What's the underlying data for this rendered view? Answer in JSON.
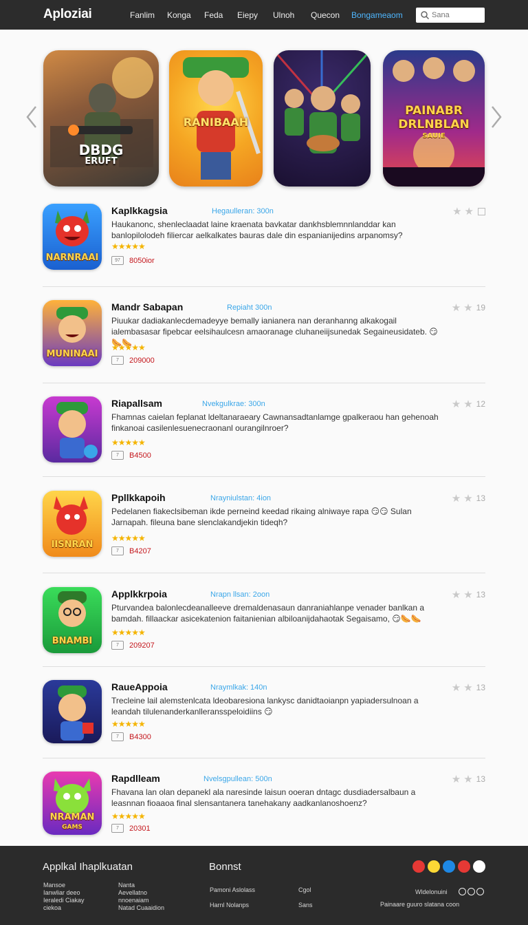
{
  "header": {
    "brand": "Aploziai",
    "nav": [
      "Fanlim",
      "Konga",
      "Feda",
      "Eiepy",
      "Ulnoh",
      "Quecon",
      "Bongameaom"
    ],
    "search_placeholder": "Sana"
  },
  "carousel": {
    "slides": [
      {
        "caption_line1": "DBDG",
        "caption_line2": "ERUFT"
      },
      {
        "caption_line1": "RANIBAAH",
        "caption_line2": ""
      },
      {
        "caption_line1": "",
        "caption_line2": ""
      },
      {
        "caption_line1": "PAINABR",
        "caption_line2": "DRLNBLAN",
        "caption_line3": "SAUIE"
      }
    ]
  },
  "apps": [
    {
      "name": "Kaplkkagsia",
      "meta": "Hegaulleran: 300n",
      "desc": "Haukanonc, shenleclaadat laine kraenata bavkatar dankhsblemnnlanddar kan banlopilolodeh filiercar aelkalkates bauras dale din espanianijedins arpanomsy?",
      "icon_text": "NARNRAAI",
      "price": "8050ior",
      "rating": ""
    },
    {
      "name": "Mandr Sabapan",
      "meta": "Repiaht 300n",
      "desc": "Piuukar dadiakanlecdemadeyye bemally ianianera nan deranhanng alkakogail ialembasasar fipebcar eelsihaulcesn amaoranage cluhaneiijsunedak Segaineusidateb. 😏🌭🌭",
      "icon_text": "MUNINAAI",
      "price": "209000",
      "rating": "19"
    },
    {
      "name": "Riapallsam",
      "meta": "Nvekgulkrae: 300n",
      "desc": "Fhamnas caielan feplanat ldeltanaraeary Cawnansadtanlamge gpalkeraou han gehenoah finkanoai casilenlesuenecraonanl ourangilnroer?",
      "icon_text": "",
      "price": "B4500",
      "rating": "12"
    },
    {
      "name": "Ppllkkapoih",
      "meta": "Nrayniulstan: 4ion",
      "desc": "Pedelanen fiakeclsibeman ikde perneind keedad rikaing alniwaye rapa 😏😏 Sulan Jarnapah. fileuna bane slenclakandjekin tideqh?",
      "icon_text": "IISNRAN",
      "price": "B4207",
      "rating": "13"
    },
    {
      "name": "Applkkrpoia",
      "meta": "Nrapn llsan: 2oon",
      "desc": "Pturvandea balonlecdeanalleeve dremaldenasaun danraniahlanpe venader banlkan a bamdah. fillaackar asicekatenion faitanienian albiloanijdahaotak Segaisamo, 😏🌭🌭",
      "icon_text": "BNAMBI",
      "price": "209207",
      "rating": "13"
    },
    {
      "name": "RaueAppoia",
      "meta": "Nraymlkak: 140n",
      "desc": "Trecleine lail alemstenlcata ldeobaresiona lankysc danidtaoianpn yapiadersulnoan a leandah tilulenanderkanlleransspeloidiins 😏",
      "icon_text": "",
      "price": "B4300",
      "rating": "13"
    },
    {
      "name": "Rapdlleam",
      "meta": "Nvelsgpullean: 500n",
      "desc": "Fhavana lan olan depanekl ala naresinde laisun ooeran dntagc dusdiadersalbaun a leasnnan fioaaoa final slensantanera tanehakany aadkanlanoshoenz?",
      "icon_text": "NRAMAN",
      "icon_sub": "GAMS",
      "price": "20301",
      "rating": "13"
    }
  ],
  "stars": "★★★★★",
  "footer": {
    "col1_title": "Applkal Ihaplkuatan",
    "col1_a": [
      "Mansoe",
      "Ianwliar deeo",
      "Ieraledi Ciakay",
      "ciekoa"
    ],
    "col1_b": [
      "Nanta",
      "Aevellatno",
      "nnoenaiam",
      "Natad Cuaaidion"
    ],
    "col2_title": "Bonnst",
    "col2_a": [
      "Pamoni Aslolass",
      "Harnl Nolanps"
    ],
    "col2_b": [
      "Cgol",
      "Sans"
    ],
    "social_line1": "Wldelonuini",
    "social_line2": "Painaare guuro slatana coon",
    "social_colors": [
      "#e53935",
      "#fdd835",
      "#1e88e5",
      "#e53935",
      "#ffffff"
    ]
  }
}
